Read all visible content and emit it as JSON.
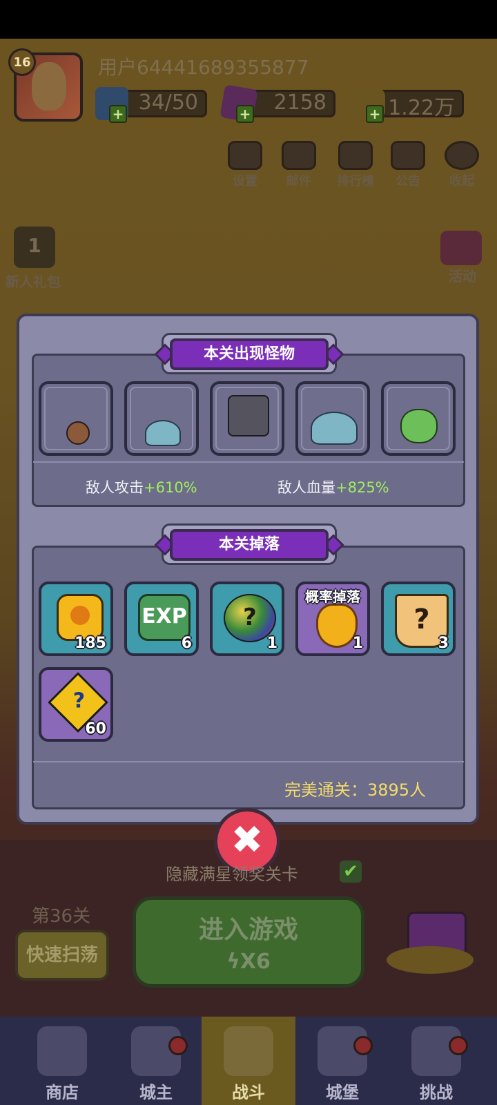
{
  "player": {
    "level": "16",
    "username": "用户64441689355877",
    "energy": "34/50",
    "gems": "2158",
    "coins": "1.22万"
  },
  "top_menu": [
    {
      "label": "设置",
      "icon": "gear-icon"
    },
    {
      "label": "邮件",
      "icon": "mail-icon"
    },
    {
      "label": "排行榜",
      "icon": "leaderboard-icon"
    },
    {
      "label": "公告",
      "icon": "megaphone-icon"
    },
    {
      "label": "收起",
      "icon": "collapse-icon"
    }
  ],
  "side": {
    "newbie_pack": "新人礼包",
    "newbie_pack_count": "1",
    "activity": "活动"
  },
  "modal": {
    "monsters_title": "本关出现怪物",
    "enemy_attack_label": "敌人攻击",
    "enemy_attack_value": "+610%",
    "enemy_hp_label": "敌人血量",
    "enemy_hp_value": "+825%",
    "drops_title": "本关掉落",
    "drops": [
      {
        "name": "gold-coin",
        "count": "185",
        "style": "teal"
      },
      {
        "name": "exp",
        "count": "6",
        "style": "teal",
        "text": "EXP"
      },
      {
        "name": "random-gems",
        "count": "1",
        "style": "teal"
      },
      {
        "name": "chance-flame-crest",
        "count": "1",
        "style": "purple",
        "tag": "概率掉落"
      },
      {
        "name": "mystery-scroll",
        "count": "3",
        "style": "teal"
      },
      {
        "name": "mystery-puzzle",
        "count": "60",
        "style": "purple"
      }
    ],
    "perfect_clear": "完美通关：3895人"
  },
  "below": {
    "hide_label": "隐藏满星领奖关卡",
    "stage": "第36关",
    "quick_sweep": "快速扫荡",
    "enter_game": "进入游戏",
    "energy_cost": "X6"
  },
  "nav": [
    {
      "label": "商店",
      "active": false
    },
    {
      "label": "城主",
      "active": false
    },
    {
      "label": "战斗",
      "active": true
    },
    {
      "label": "城堡",
      "active": false
    },
    {
      "label": "挑战",
      "active": false
    }
  ]
}
